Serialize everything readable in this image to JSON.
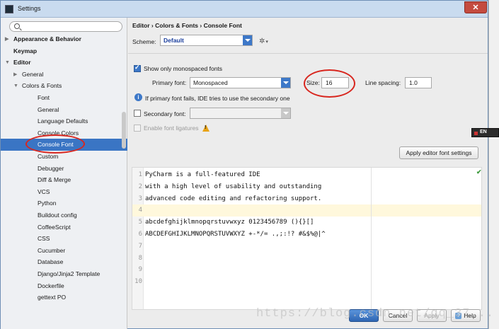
{
  "window": {
    "title": "Settings",
    "close_label": "✕"
  },
  "sidebar": {
    "search": {
      "value": "",
      "placeholder": ""
    },
    "items": [
      {
        "label": "Appearance & Behavior",
        "level": 0,
        "arrow": "▶",
        "bold": true
      },
      {
        "label": "Keymap",
        "level": 0,
        "arrow": "",
        "bold": true
      },
      {
        "label": "Editor",
        "level": 0,
        "arrow": "▼",
        "bold": true
      },
      {
        "label": "General",
        "level": 1,
        "arrow": "▶"
      },
      {
        "label": "Colors & Fonts",
        "level": 1,
        "arrow": "▼"
      },
      {
        "label": "Font",
        "level": 2,
        "arrow": ""
      },
      {
        "label": "General",
        "level": 2,
        "arrow": ""
      },
      {
        "label": "Language Defaults",
        "level": 2,
        "arrow": ""
      },
      {
        "label": "Console Colors",
        "level": 2,
        "arrow": ""
      },
      {
        "label": "Console Font",
        "level": 2,
        "arrow": "",
        "selected": true
      },
      {
        "label": "Custom",
        "level": 2,
        "arrow": ""
      },
      {
        "label": "Debugger",
        "level": 2,
        "arrow": ""
      },
      {
        "label": "Diff & Merge",
        "level": 2,
        "arrow": ""
      },
      {
        "label": "VCS",
        "level": 2,
        "arrow": ""
      },
      {
        "label": "Python",
        "level": 2,
        "arrow": ""
      },
      {
        "label": "Buildout config",
        "level": 2,
        "arrow": ""
      },
      {
        "label": "CoffeeScript",
        "level": 2,
        "arrow": ""
      },
      {
        "label": "CSS",
        "level": 2,
        "arrow": ""
      },
      {
        "label": "Cucumber",
        "level": 2,
        "arrow": ""
      },
      {
        "label": "Database",
        "level": 2,
        "arrow": ""
      },
      {
        "label": "Django/Jinja2 Template",
        "level": 2,
        "arrow": ""
      },
      {
        "label": "Dockerfile",
        "level": 2,
        "arrow": ""
      },
      {
        "label": "gettext PO",
        "level": 2,
        "arrow": ""
      }
    ]
  },
  "main": {
    "breadcrumb": "Editor › Colors & Fonts › Console Font",
    "scheme_label": "Scheme:",
    "scheme_value": "Default",
    "monospaced_only": {
      "label": "Show only monospaced fonts",
      "checked": true
    },
    "primary_font": {
      "label": "Primary font:",
      "value": "Monospaced"
    },
    "size": {
      "label": "Size:",
      "value": "16"
    },
    "line_spacing": {
      "label": "Line spacing:",
      "value": "1.0"
    },
    "info_text": "If primary font fails, IDE tries to use the secondary one",
    "secondary_font": {
      "label": "Secondary font:",
      "value": "",
      "checked": false
    },
    "ligatures": {
      "label": "Enable font ligatures",
      "checked": false
    },
    "apply_font_settings_label": "Apply editor font settings"
  },
  "preview": {
    "lines": [
      {
        "num": "1",
        "text": "PyCharm is a full-featured IDE"
      },
      {
        "num": "2",
        "text": "with a high level of usability and outstanding"
      },
      {
        "num": "3",
        "text": "advanced code editing and refactoring support."
      },
      {
        "num": "4",
        "text": "",
        "caret": true
      },
      {
        "num": "5",
        "text": "abcdefghijklmnopqrstuvwxyz 0123456789 (){}[]"
      },
      {
        "num": "6",
        "text": "ABCDEFGHIJKLMNOPQRSTUVWXYZ +-*/= .,;:!? #&$%@|^"
      },
      {
        "num": "7",
        "text": ""
      },
      {
        "num": "8",
        "text": ""
      },
      {
        "num": "9",
        "text": ""
      },
      {
        "num": "10",
        "text": ""
      }
    ]
  },
  "footer": {
    "ok": "OK",
    "cancel": "Cancel",
    "apply": "Apply",
    "help": "Help"
  },
  "watermark": "https://blog.csdn.net/qq_37...",
  "ime": {
    "label": "EN"
  },
  "colors": {
    "selection": "#3a75c4",
    "accent": "#3d78c8",
    "highlight_circle": "#d8261e"
  }
}
